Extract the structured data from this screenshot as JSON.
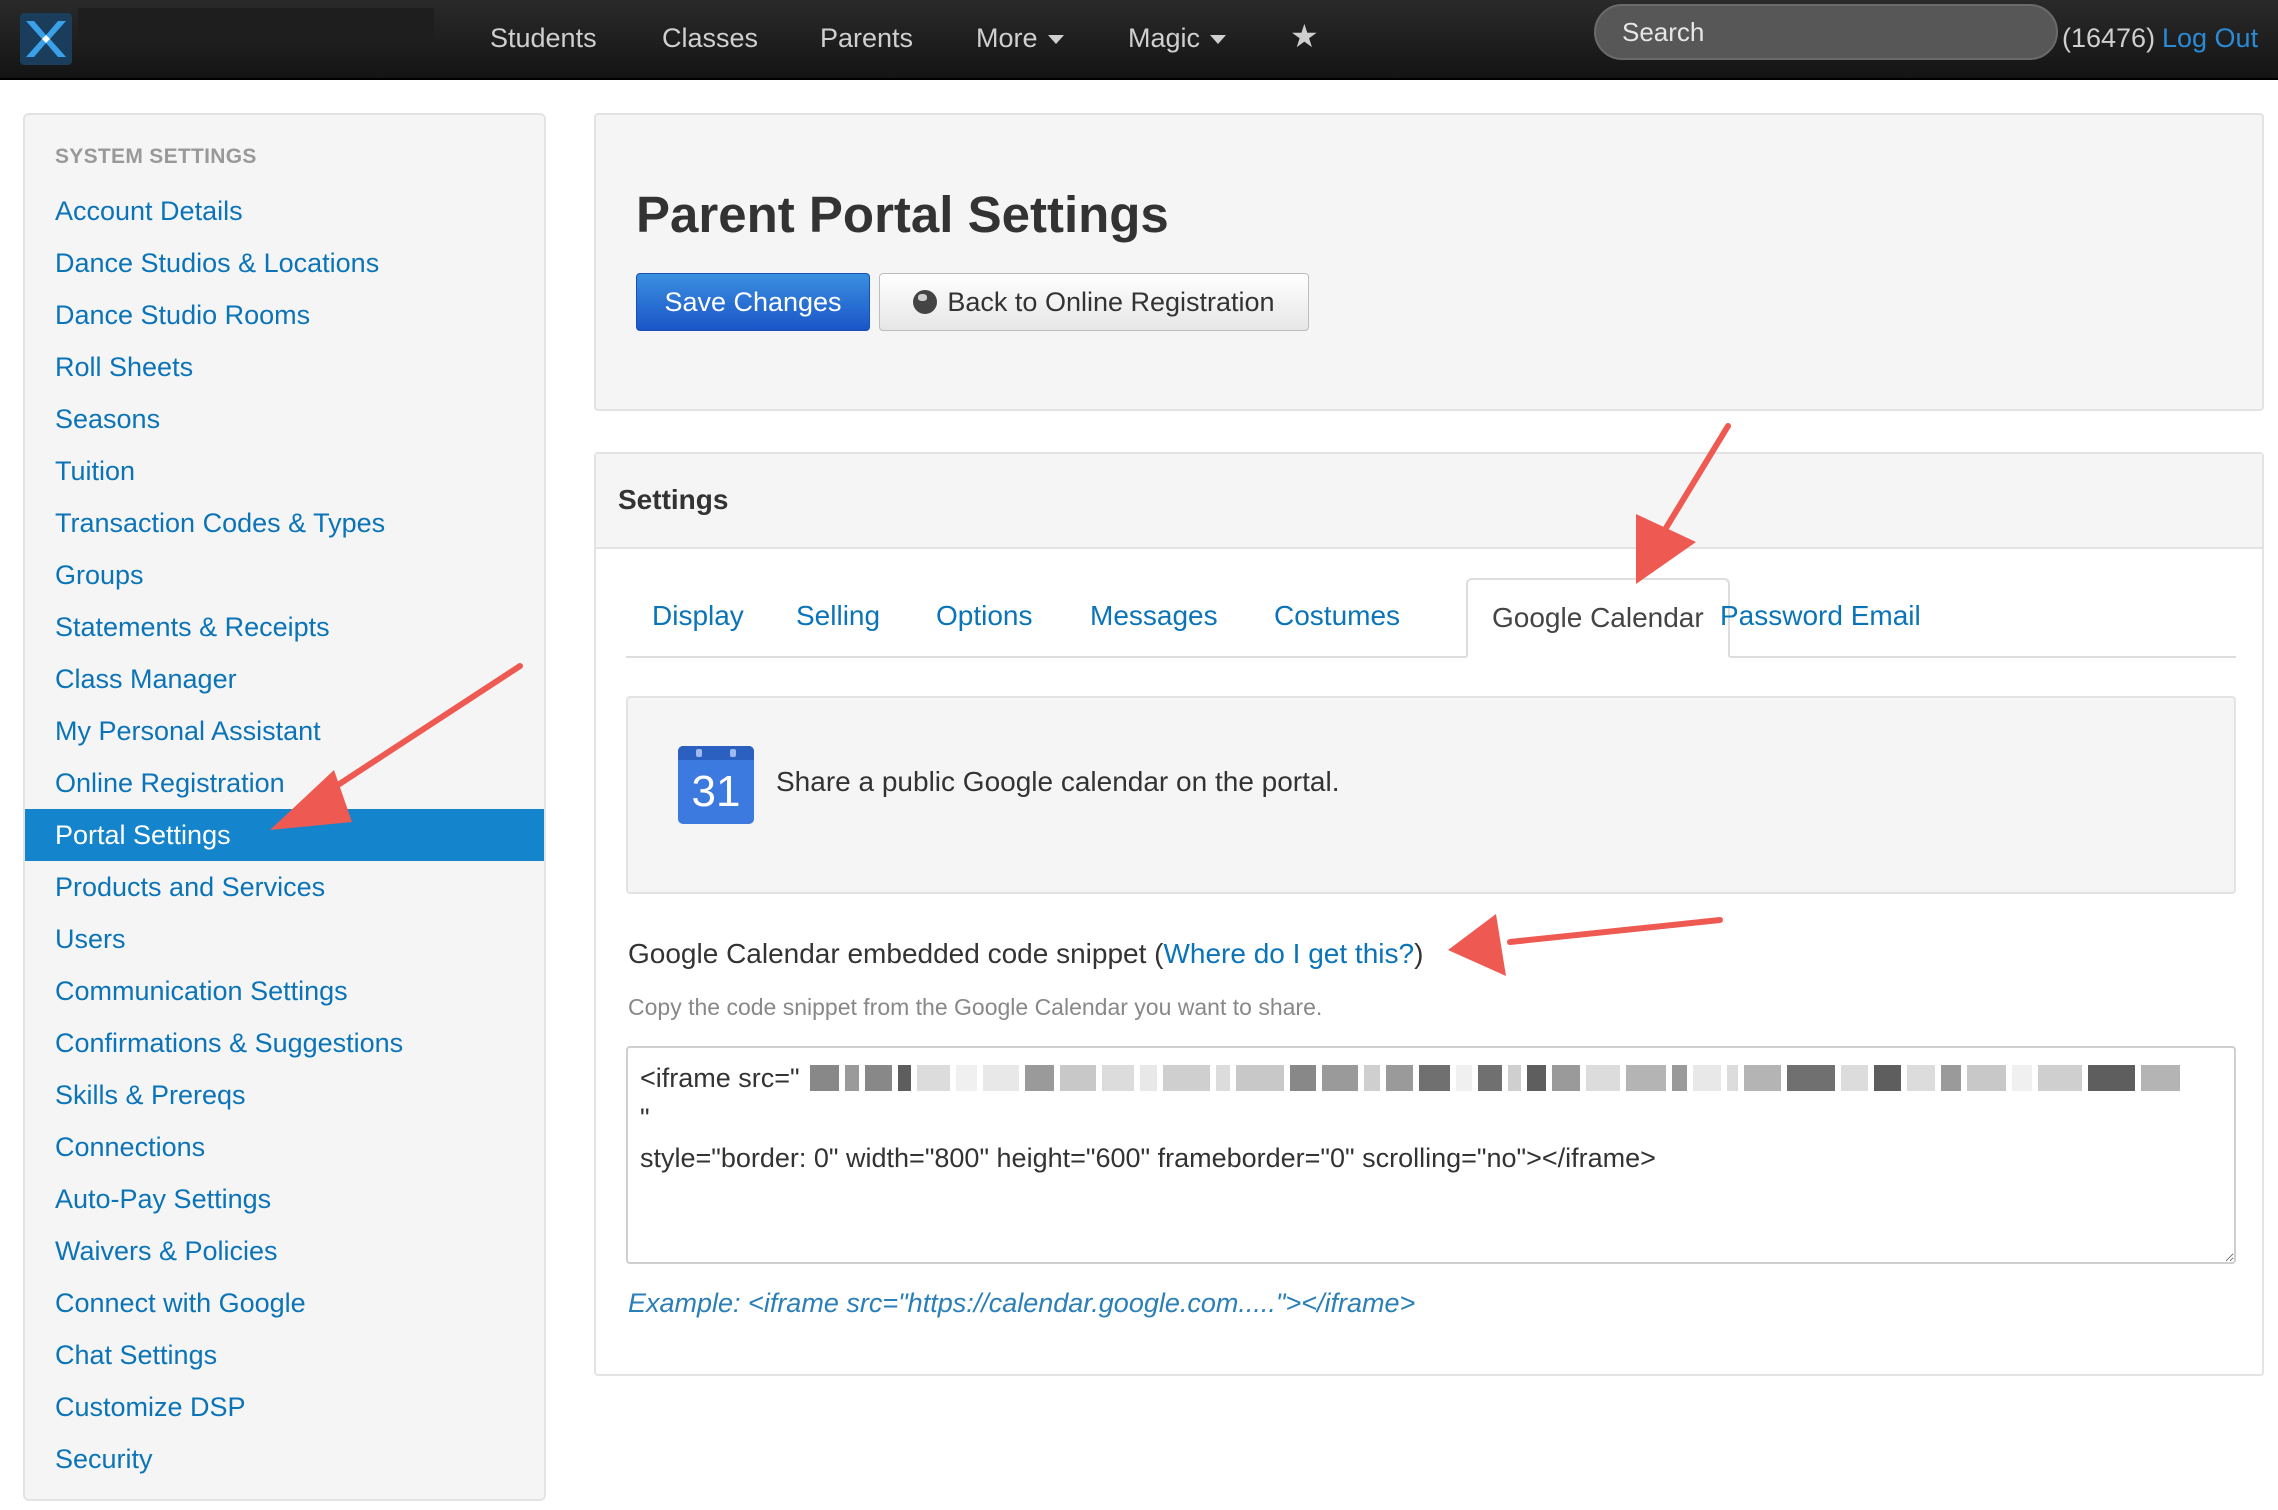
{
  "topnav": {
    "items": [
      {
        "label": "Students"
      },
      {
        "label": "Classes"
      },
      {
        "label": "Parents"
      },
      {
        "label": "More"
      },
      {
        "label": "Magic"
      }
    ],
    "search_placeholder": "Search",
    "user_count": "(16476)",
    "logout_label": "Log Out"
  },
  "sidebar": {
    "heading": "SYSTEM SETTINGS",
    "items": [
      {
        "label": "Account Details"
      },
      {
        "label": "Dance Studios & Locations"
      },
      {
        "label": "Dance Studio Rooms"
      },
      {
        "label": "Roll Sheets"
      },
      {
        "label": "Seasons"
      },
      {
        "label": "Tuition"
      },
      {
        "label": "Transaction Codes & Types"
      },
      {
        "label": "Groups"
      },
      {
        "label": "Statements & Receipts"
      },
      {
        "label": "Class Manager"
      },
      {
        "label": "My Personal Assistant"
      },
      {
        "label": "Online Registration"
      },
      {
        "label": "Portal Settings"
      },
      {
        "label": "Products and Services"
      },
      {
        "label": "Users"
      },
      {
        "label": "Communication Settings"
      },
      {
        "label": "Confirmations & Suggestions"
      },
      {
        "label": "Skills & Prereqs"
      },
      {
        "label": "Connections"
      },
      {
        "label": "Auto-Pay Settings"
      },
      {
        "label": "Waivers & Policies"
      },
      {
        "label": "Connect with Google"
      },
      {
        "label": "Chat Settings"
      },
      {
        "label": "Customize DSP"
      },
      {
        "label": "Security"
      }
    ],
    "active_item": "Portal Settings"
  },
  "header": {
    "title": "Parent Portal Settings",
    "save_label": "Save Changes",
    "back_label": "Back to Online Registration"
  },
  "settings": {
    "title": "Settings",
    "tabs": [
      {
        "label": "Display"
      },
      {
        "label": "Selling"
      },
      {
        "label": "Options"
      },
      {
        "label": "Messages"
      },
      {
        "label": "Costumes"
      },
      {
        "label": "Google Calendar"
      },
      {
        "label": "Password Email"
      }
    ],
    "active_tab": "Google Calendar",
    "calendar_icon_number": "31",
    "info_text": "Share a public Google calendar on the portal.",
    "snippet_label": "Google Calendar embedded code snippet (",
    "snippet_link": "Where do I get this?",
    "snippet_label_end": ")",
    "snippet_help": "Copy the code snippet from the Google Calendar you want to share.",
    "snippet_value": "<iframe src=\"\n\"\nstyle=\"border: 0\" width=\"800\" height=\"600\" frameborder=\"0\" scrolling=\"no\"></iframe>",
    "example": "Example: <iframe src=\"https://calendar.google.com.....\"></iframe>"
  },
  "colors": {
    "accent": "#0b74b8",
    "active_bg": "#1484cd",
    "save_button": "#1a55c8",
    "annotation_arrow": "#ee5a52"
  }
}
